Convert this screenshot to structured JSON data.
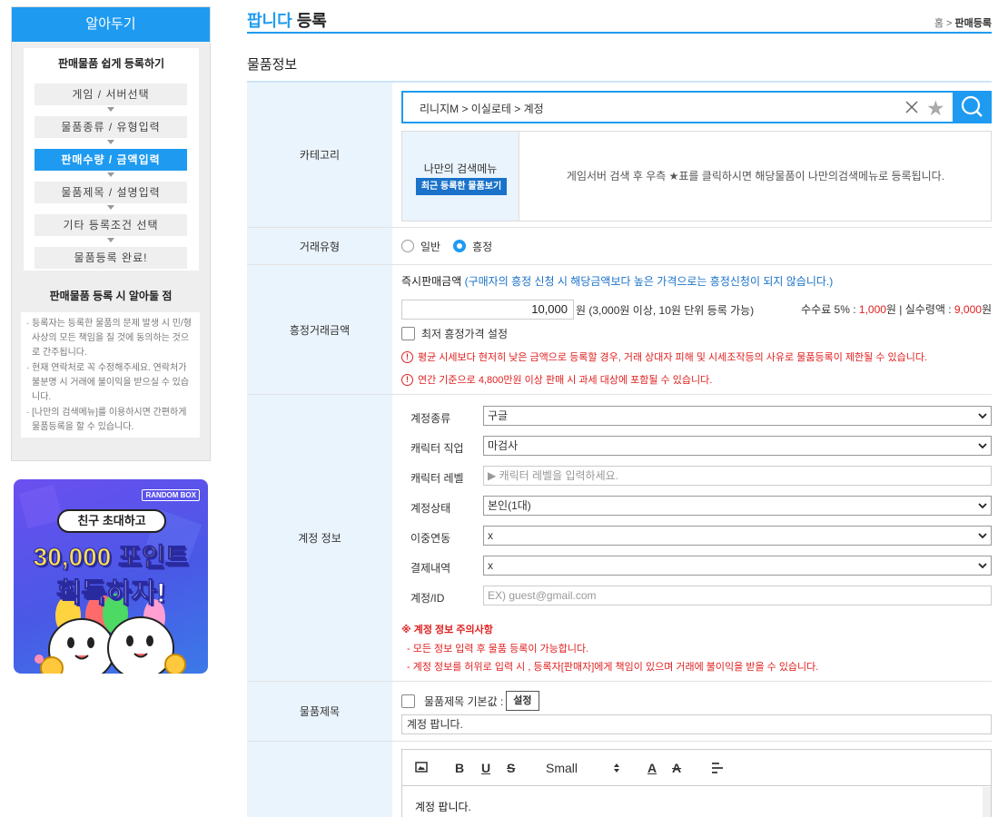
{
  "sidebar": {
    "header": "알아두기",
    "steps_title": "판매물품 쉽게 등록하기",
    "steps": [
      "게임 / 서버선택",
      "물품종류 / 유형입력",
      "판매수량 / 금액입력",
      "물품제목 / 설명입력",
      "기타 등록조건 선택",
      "물품등록 완료!"
    ],
    "active_step": 2,
    "notes_title": "판매물품 등록 시 알아둘 점",
    "notes": [
      "· 등록자는 등록한 물품의 문제 발생 시 민/형사상의 모든 책임을 질 것에 동의하는 것으로 간주됩니다.",
      "· 현재 연락처로 꼭 수정해주세요. 연락처가 불분명 시 거래에 불이익을 받으실 수 있습니다.",
      "· [나만의 검색메뉴]를 이용하시면 간편하게 물품등록을 할 수 있습니다."
    ]
  },
  "banner": {
    "brand": "RANDOM BOX",
    "pill": "친구 초대하고",
    "line1": "30,000 포인트",
    "line2": "획득하자!"
  },
  "page": {
    "title_accent": "팝니다",
    "title_rest": " 등록",
    "breadcrumb_home": "홈",
    "breadcrumb_sep": " > ",
    "breadcrumb_current": "판매등록",
    "section_title": "물품정보"
  },
  "category": {
    "label": "카테고리",
    "value": "리니지M > 이실로테 > 계정",
    "my_menu_title": "나만의 검색메뉴",
    "my_menu_button": "최근 등록한 물품보기",
    "my_menu_message": "게임서버 검색 후 우측 ★표를 클릭하시면 해당물품이 나만의검색메뉴로 등록됩니다."
  },
  "trade_type": {
    "label": "거래유형",
    "options": [
      "일반",
      "흥정"
    ],
    "selected": "흥정"
  },
  "price": {
    "label": "흥정거래금액",
    "head": "즉시판매금액",
    "head_note": "(구매자의 흥정 신청 시 해당금액보다 높은 가격으로는 흥정신청이 되지 않습니다.)",
    "value": "10,000",
    "unit_note": "원 (3,000원 이상, 10원 단위 등록 가능)",
    "fee_prefix": "수수료 5% : ",
    "fee_value": "1,000",
    "fee_mid": "원 | 실수령액 : ",
    "net_value": "9,000",
    "fee_suffix": "원",
    "min_price_label": "최저 흥정가격 설정",
    "warnings": [
      "평균 시세보다 현저히 낮은 금액으로 등록할 경우, 거래 상대자 피해 및 시세조작등의 사유로 물품등록이 제한될 수 있습니다.",
      "연간 기준으로 4,800만원 이상 판매 시 과세 대상에 포함될 수 있습니다."
    ]
  },
  "account": {
    "label": "계정 정보",
    "fields": [
      {
        "label": "계정종류",
        "value": "구글"
      },
      {
        "label": "캐릭터 직업",
        "value": "마검사"
      },
      {
        "label": "캐릭터 레벨",
        "placeholder": "▶ 캐릭터 레벨을 입력하세요."
      },
      {
        "label": "계정상태",
        "value": "본인(1대)"
      },
      {
        "label": "이중연동",
        "value": "x"
      },
      {
        "label": "결제내역",
        "value": "x"
      },
      {
        "label": "계정/ID",
        "placeholder": "EX) guest@gmail.com"
      }
    ],
    "notice_title": "※ 계정 정보 주의사항",
    "notices": [
      "- 모든 정보 입력 후 물품 등록이 가능합니다.",
      "- 계정 정보를 허위로 입력 시 , 등록자[판매자]에게 책임이 있으며 거래에 불이익을 받을 수 있습니다."
    ]
  },
  "item_title": {
    "label": "물품제목",
    "default_label": "물품제목 기본값 :",
    "set_button": "설정",
    "value": "계정 팝니다."
  },
  "editor": {
    "font_size": "Small",
    "text": "계정 팝니다."
  },
  "colors": {
    "accent": "#1e9bf0",
    "label_bg": "#eaf4fd",
    "warning": "#e02020"
  }
}
